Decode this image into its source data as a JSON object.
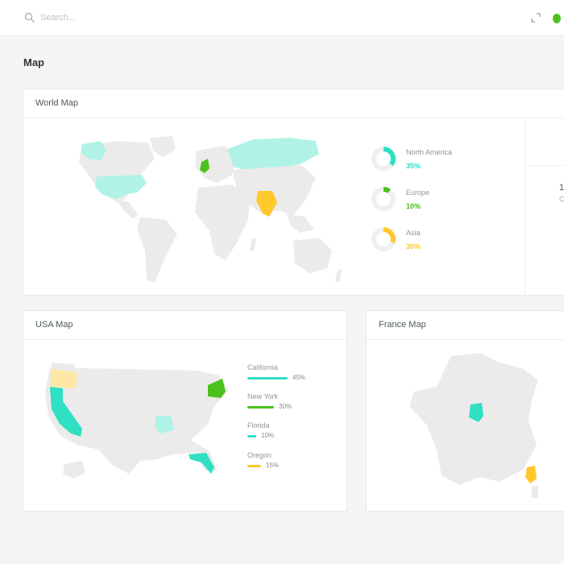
{
  "search": {
    "placeholder": "Search..."
  },
  "page": {
    "title": "Map"
  },
  "world_card": {
    "title": "World Map",
    "regions": [
      {
        "name": "North America",
        "percent": "35%",
        "value": 0.35,
        "color": "#2fe0c3"
      },
      {
        "name": "Europe",
        "percent": "10%",
        "value": 0.1,
        "color": "#4cc11e"
      },
      {
        "name": "Asia",
        "percent": "30%",
        "value": 0.3,
        "color": "#ffc82c"
      }
    ],
    "side_number": "1:",
    "side_sub": "C"
  },
  "usa_card": {
    "title": "USA Map",
    "states": [
      {
        "name": "California",
        "percent": "45%",
        "value": 0.45,
        "color": "#2fe0c3"
      },
      {
        "name": "New York",
        "percent": "30%",
        "value": 0.3,
        "color": "#4cc11e"
      },
      {
        "name": "Florida",
        "percent": "10%",
        "value": 0.1,
        "color": "#2fe0c3"
      },
      {
        "name": "Oregon",
        "percent": "15%",
        "value": 0.15,
        "color": "#ffc82c"
      }
    ]
  },
  "france_card": {
    "title": "France Map"
  },
  "colors": {
    "accent_teal": "#2fe0c3",
    "accent_green": "#4cc11e",
    "accent_yellow": "#ffc82c",
    "land_gray": "#ebebeb",
    "light_teal": "#b0f3e6"
  },
  "icons": [
    "search-icon",
    "expand-icon",
    "status-dot"
  ]
}
